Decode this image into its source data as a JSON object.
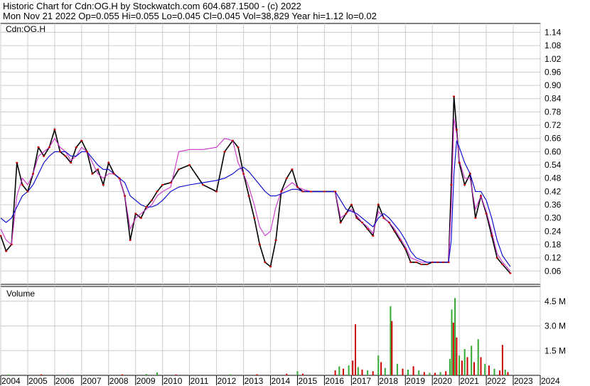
{
  "header": {
    "title": "Historic Chart for Cdn:OG.H by Stockwatch.com 604.687.1500 - (c) 2022",
    "subtitle": "Mon Nov 21 2022   Op=0.055  Hi=0.055  Lo=0.045  Cl=0.045  Vol=38,829  Year hi=1.12  lo=0.02"
  },
  "chart_data": [
    {
      "type": "line",
      "title": "",
      "legend": "Cdn:OG.H",
      "ylabel": "",
      "ylim": [
        0.0,
        1.18
      ],
      "yticks": [
        0.06,
        0.12,
        0.18,
        0.24,
        0.3,
        0.36,
        0.42,
        0.48,
        0.54,
        0.6,
        0.66,
        0.72,
        0.78,
        0.84,
        0.9,
        0.96,
        1.02,
        1.08,
        1.14
      ],
      "ytick_labels": [
        "0.06",
        "0.12",
        "0.18",
        "0.24",
        "0.30",
        "0.36",
        "0.42",
        "0.48",
        "0.54",
        "0.60",
        "0.66",
        "0.72",
        "0.78",
        "0.84",
        "0.90",
        "0.96",
        "1.02",
        "1.08",
        "1.14"
      ],
      "xlim": [
        2004.0,
        2024.0
      ],
      "grid": true,
      "colors": {
        "price": "#000000",
        "close": "#cc0000",
        "ma_short": "#cc33cc",
        "ma_long": "#0000cc"
      },
      "x": [
        2004.0,
        2004.2,
        2004.4,
        2004.6,
        2004.8,
        2005.0,
        2005.2,
        2005.4,
        2005.6,
        2005.8,
        2006.0,
        2006.2,
        2006.4,
        2006.6,
        2006.8,
        2007.0,
        2007.2,
        2007.4,
        2007.6,
        2007.8,
        2008.0,
        2008.2,
        2008.4,
        2008.6,
        2008.8,
        2009.0,
        2009.2,
        2009.4,
        2009.6,
        2009.8,
        2010.0,
        2010.3,
        2010.6,
        2011.0,
        2011.5,
        2012.0,
        2012.3,
        2012.6,
        2012.8,
        2013.0,
        2013.2,
        2013.4,
        2013.6,
        2013.8,
        2014.0,
        2014.2,
        2014.4,
        2014.6,
        2014.8,
        2015.0,
        2015.2,
        2015.5,
        2016.0,
        2016.4,
        2016.6,
        2016.8,
        2017.0,
        2017.2,
        2017.4,
        2017.6,
        2017.8,
        2018.0,
        2018.2,
        2018.4,
        2018.6,
        2018.8,
        2019.0,
        2019.2,
        2019.4,
        2019.6,
        2019.8,
        2020.0,
        2020.2,
        2020.4,
        2020.6,
        2020.7,
        2020.8,
        2020.9,
        2021.0,
        2021.2,
        2021.4,
        2021.6,
        2021.8,
        2022.0,
        2022.2,
        2022.4,
        2022.6,
        2022.89
      ],
      "series": [
        {
          "key": "price",
          "values": [
            0.22,
            0.15,
            0.18,
            0.55,
            0.45,
            0.42,
            0.5,
            0.62,
            0.58,
            0.62,
            0.7,
            0.6,
            0.58,
            0.55,
            0.62,
            0.65,
            0.6,
            0.5,
            0.52,
            0.45,
            0.55,
            0.5,
            0.48,
            0.4,
            0.2,
            0.32,
            0.3,
            0.35,
            0.38,
            0.42,
            0.45,
            0.46,
            0.52,
            0.54,
            0.45,
            0.42,
            0.6,
            0.65,
            0.62,
            0.5,
            0.4,
            0.3,
            0.18,
            0.1,
            0.08,
            0.2,
            0.42,
            0.48,
            0.52,
            0.44,
            0.42,
            0.42,
            0.42,
            0.42,
            0.28,
            0.32,
            0.36,
            0.3,
            0.28,
            0.25,
            0.22,
            0.36,
            0.3,
            0.28,
            0.24,
            0.2,
            0.16,
            0.1,
            0.1,
            0.09,
            0.09,
            0.1,
            0.1,
            0.1,
            0.1,
            0.45,
            0.85,
            0.7,
            0.55,
            0.45,
            0.5,
            0.3,
            0.4,
            0.32,
            0.22,
            0.12,
            0.09,
            0.05
          ]
        },
        {
          "key": "ma_short",
          "values": [
            0.25,
            0.2,
            0.18,
            0.4,
            0.48,
            0.45,
            0.5,
            0.58,
            0.6,
            0.62,
            0.66,
            0.62,
            0.6,
            0.56,
            0.58,
            0.62,
            0.6,
            0.55,
            0.5,
            0.48,
            0.5,
            0.5,
            0.48,
            0.4,
            0.25,
            0.3,
            0.32,
            0.34,
            0.36,
            0.4,
            0.42,
            0.44,
            0.6,
            0.61,
            0.61,
            0.62,
            0.66,
            0.65,
            0.55,
            0.5,
            0.44,
            0.36,
            0.26,
            0.22,
            0.24,
            0.35,
            0.42,
            0.44,
            0.46,
            0.44,
            0.43,
            0.42,
            0.42,
            0.42,
            0.3,
            0.32,
            0.34,
            0.31,
            0.28,
            0.26,
            0.23,
            0.33,
            0.3,
            0.28,
            0.25,
            0.21,
            0.17,
            0.12,
            0.11,
            0.1,
            0.1,
            0.1,
            0.1,
            0.1,
            0.1,
            0.35,
            0.75,
            0.68,
            0.56,
            0.48,
            0.48,
            0.34,
            0.4,
            0.33,
            0.24,
            0.14,
            0.1,
            0.06
          ]
        },
        {
          "key": "ma_long",
          "values": [
            0.3,
            0.28,
            0.3,
            0.35,
            0.4,
            0.42,
            0.45,
            0.5,
            0.55,
            0.58,
            0.6,
            0.6,
            0.6,
            0.58,
            0.58,
            0.6,
            0.6,
            0.57,
            0.54,
            0.52,
            0.52,
            0.5,
            0.48,
            0.46,
            0.4,
            0.38,
            0.36,
            0.35,
            0.35,
            0.36,
            0.38,
            0.42,
            0.44,
            0.45,
            0.46,
            0.47,
            0.48,
            0.5,
            0.52,
            0.53,
            0.51,
            0.48,
            0.45,
            0.42,
            0.4,
            0.4,
            0.41,
            0.42,
            0.43,
            0.43,
            0.42,
            0.42,
            0.42,
            0.42,
            0.38,
            0.34,
            0.33,
            0.32,
            0.3,
            0.28,
            0.26,
            0.3,
            0.32,
            0.3,
            0.27,
            0.24,
            0.2,
            0.15,
            0.12,
            0.11,
            0.1,
            0.1,
            0.1,
            0.1,
            0.1,
            0.2,
            0.5,
            0.65,
            0.62,
            0.55,
            0.5,
            0.42,
            0.42,
            0.38,
            0.3,
            0.2,
            0.13,
            0.08
          ]
        }
      ]
    },
    {
      "type": "bar",
      "title": "Volume",
      "ylim": [
        0,
        5.4
      ],
      "yticks": [
        1.5,
        3.0,
        4.5
      ],
      "ytick_labels": [
        "1.5 M",
        "3.0 M",
        "4.5 M"
      ],
      "xlim": [
        2004.0,
        2024.0
      ],
      "xticks": [
        2004,
        2005,
        2006,
        2007,
        2008,
        2009,
        2010,
        2011,
        2012,
        2013,
        2014,
        2015,
        2016,
        2017,
        2018,
        2019,
        2020,
        2021,
        2022,
        2023,
        2024
      ],
      "xtick_labels": [
        "2004",
        "2005",
        "2006",
        "2007",
        "2008",
        "2009",
        "2010",
        "2011",
        "2012",
        "2013",
        "2014",
        "2015",
        "2016",
        "2017",
        "2018",
        "2019",
        "2020",
        "2021",
        "2022",
        "2023",
        "2024"
      ],
      "colors": {
        "up": "#33aa33",
        "down": "#cc0000"
      },
      "bars": [
        {
          "x": 2004.3,
          "v": 0.05,
          "c": "up"
        },
        {
          "x": 2005.5,
          "v": 0.06,
          "c": "down"
        },
        {
          "x": 2006.5,
          "v": 0.05,
          "c": "up"
        },
        {
          "x": 2008.5,
          "v": 0.06,
          "c": "down"
        },
        {
          "x": 2009.4,
          "v": 0.08,
          "c": "up"
        },
        {
          "x": 2009.8,
          "v": 0.18,
          "c": "up"
        },
        {
          "x": 2010.5,
          "v": 0.05,
          "c": "down"
        },
        {
          "x": 2012.5,
          "v": 0.06,
          "c": "up"
        },
        {
          "x": 2013.5,
          "v": 0.07,
          "c": "down"
        },
        {
          "x": 2014.6,
          "v": 0.1,
          "c": "down"
        },
        {
          "x": 2015.0,
          "v": 0.25,
          "c": "up"
        },
        {
          "x": 2015.2,
          "v": 0.1,
          "c": "down"
        },
        {
          "x": 2016.4,
          "v": 0.3,
          "c": "down"
        },
        {
          "x": 2016.55,
          "v": 0.55,
          "c": "up"
        },
        {
          "x": 2016.7,
          "v": 0.4,
          "c": "down"
        },
        {
          "x": 2016.9,
          "v": 0.6,
          "c": "up"
        },
        {
          "x": 2017.05,
          "v": 0.9,
          "c": "down"
        },
        {
          "x": 2017.15,
          "v": 3.1,
          "c": "down"
        },
        {
          "x": 2017.25,
          "v": 0.5,
          "c": "up"
        },
        {
          "x": 2017.4,
          "v": 0.35,
          "c": "down"
        },
        {
          "x": 2017.6,
          "v": 0.3,
          "c": "up"
        },
        {
          "x": 2017.8,
          "v": 0.25,
          "c": "down"
        },
        {
          "x": 2018.0,
          "v": 1.2,
          "c": "up"
        },
        {
          "x": 2018.1,
          "v": 0.8,
          "c": "down"
        },
        {
          "x": 2018.25,
          "v": 0.45,
          "c": "up"
        },
        {
          "x": 2018.45,
          "v": 4.2,
          "c": "up"
        },
        {
          "x": 2018.5,
          "v": 3.3,
          "c": "down"
        },
        {
          "x": 2018.7,
          "v": 0.7,
          "c": "up"
        },
        {
          "x": 2018.9,
          "v": 0.4,
          "c": "down"
        },
        {
          "x": 2019.1,
          "v": 0.35,
          "c": "up"
        },
        {
          "x": 2019.3,
          "v": 0.55,
          "c": "down"
        },
        {
          "x": 2019.5,
          "v": 0.3,
          "c": "up"
        },
        {
          "x": 2019.7,
          "v": 0.2,
          "c": "down"
        },
        {
          "x": 2019.9,
          "v": 0.15,
          "c": "up"
        },
        {
          "x": 2020.1,
          "v": 0.15,
          "c": "down"
        },
        {
          "x": 2020.3,
          "v": 0.2,
          "c": "up"
        },
        {
          "x": 2020.5,
          "v": 0.25,
          "c": "down"
        },
        {
          "x": 2020.65,
          "v": 1.0,
          "c": "up"
        },
        {
          "x": 2020.72,
          "v": 4.0,
          "c": "up"
        },
        {
          "x": 2020.78,
          "v": 3.2,
          "c": "down"
        },
        {
          "x": 2020.84,
          "v": 4.7,
          "c": "up"
        },
        {
          "x": 2020.9,
          "v": 2.3,
          "c": "down"
        },
        {
          "x": 2021.0,
          "v": 1.2,
          "c": "up"
        },
        {
          "x": 2021.1,
          "v": 0.9,
          "c": "down"
        },
        {
          "x": 2021.2,
          "v": 1.6,
          "c": "up"
        },
        {
          "x": 2021.3,
          "v": 1.1,
          "c": "down"
        },
        {
          "x": 2021.45,
          "v": 1.8,
          "c": "up"
        },
        {
          "x": 2021.55,
          "v": 0.8,
          "c": "down"
        },
        {
          "x": 2021.7,
          "v": 2.2,
          "c": "up"
        },
        {
          "x": 2021.8,
          "v": 1.1,
          "c": "down"
        },
        {
          "x": 2021.95,
          "v": 0.7,
          "c": "up"
        },
        {
          "x": 2022.1,
          "v": 0.6,
          "c": "down"
        },
        {
          "x": 2022.3,
          "v": 0.4,
          "c": "up"
        },
        {
          "x": 2022.5,
          "v": 0.3,
          "c": "down"
        },
        {
          "x": 2022.6,
          "v": 1.85,
          "c": "down"
        },
        {
          "x": 2022.7,
          "v": 0.35,
          "c": "up"
        },
        {
          "x": 2022.8,
          "v": 0.2,
          "c": "down"
        }
      ]
    }
  ]
}
